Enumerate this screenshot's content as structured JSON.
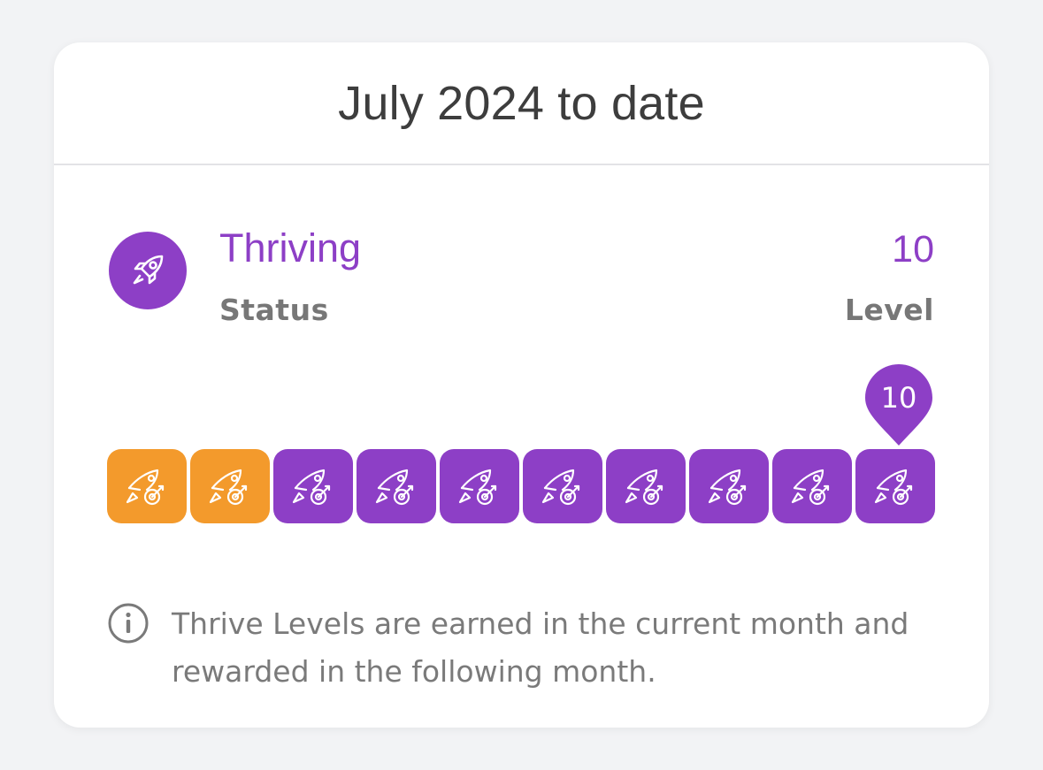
{
  "header": {
    "title": "July 2024 to date"
  },
  "status": {
    "icon": "rocket-icon",
    "value": "Thriving",
    "label": "Status"
  },
  "level": {
    "value": "10",
    "label": "Level"
  },
  "progress": {
    "current_level": 10,
    "total_levels": 10,
    "marker_label": "10",
    "tiles": [
      {
        "color": "#f39a2c",
        "icon": "rocket-target-icon"
      },
      {
        "color": "#f39a2c",
        "icon": "rocket-target-icon"
      },
      {
        "color": "#8d3fc6",
        "icon": "rocket-target-icon"
      },
      {
        "color": "#8d3fc6",
        "icon": "rocket-target-icon"
      },
      {
        "color": "#8d3fc6",
        "icon": "rocket-target-icon"
      },
      {
        "color": "#8d3fc6",
        "icon": "rocket-target-icon"
      },
      {
        "color": "#8d3fc6",
        "icon": "rocket-target-icon"
      },
      {
        "color": "#8d3fc6",
        "icon": "rocket-target-icon"
      },
      {
        "color": "#8d3fc6",
        "icon": "rocket-target-icon"
      },
      {
        "color": "#8d3fc6",
        "icon": "rocket-target-icon"
      }
    ]
  },
  "info": {
    "icon": "info-icon",
    "text": "Thrive Levels are earned in the current month and rewarded in the following month."
  },
  "colors": {
    "accent": "#8d3fc6",
    "orange": "#f39a2c",
    "text_muted": "#777777"
  }
}
